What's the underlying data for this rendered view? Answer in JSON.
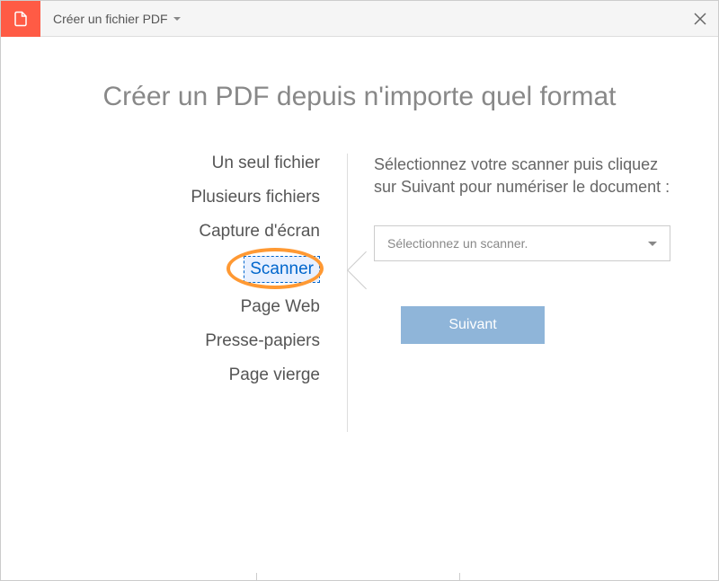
{
  "header": {
    "title": "Créer un fichier PDF"
  },
  "page_title": "Créer un PDF depuis n'importe quel format",
  "options": {
    "single_file": "Un seul fichier",
    "multiple_files": "Plusieurs fichiers",
    "screenshot": "Capture d'écran",
    "scanner": "Scanner",
    "web_page": "Page Web",
    "clipboard": "Presse-papiers",
    "blank_page": "Page vierge"
  },
  "right_panel": {
    "instruction": "Sélectionnez votre scanner puis cliquez sur Suivant pour numériser le document :",
    "select_placeholder": "Sélectionnez un scanner.",
    "next_button": "Suivant"
  }
}
